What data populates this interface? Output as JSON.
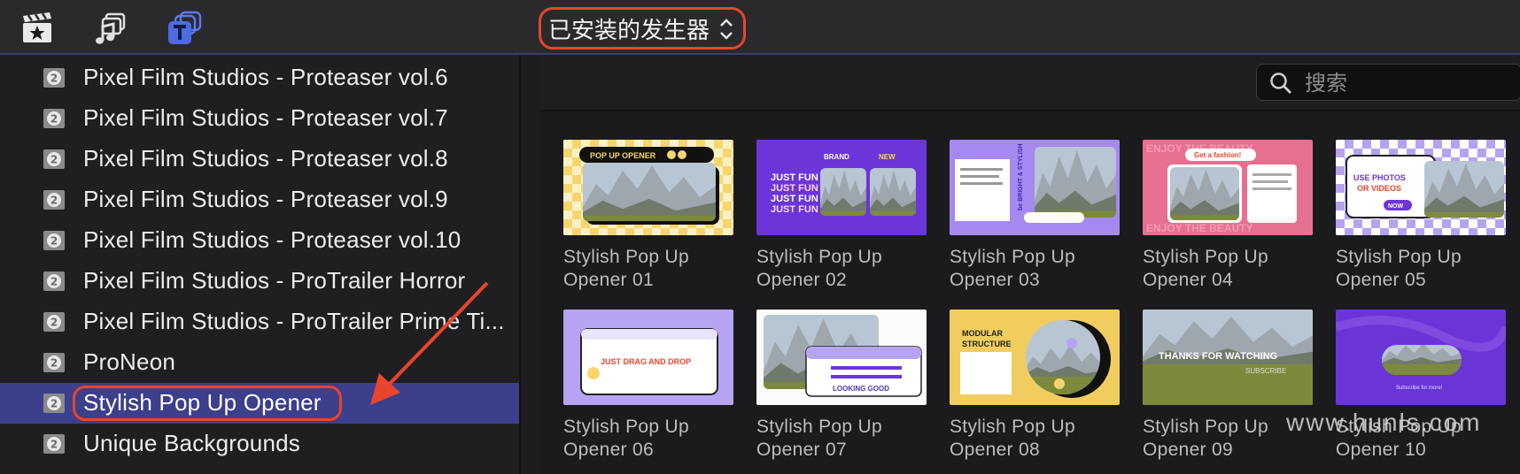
{
  "toolbar": {
    "icons": [
      "clapper-star-icon",
      "music-photo-icon",
      "titles-icon"
    ],
    "library_selector": "已安装的发生器"
  },
  "sidebar": {
    "items": [
      {
        "label": "Pixel Film Studios - Proteaser vol.6"
      },
      {
        "label": "Pixel Film Studios - Proteaser vol.7"
      },
      {
        "label": "Pixel Film Studios - Proteaser vol.8"
      },
      {
        "label": "Pixel Film Studios - Proteaser vol.9"
      },
      {
        "label": "Pixel Film Studios - Proteaser vol.10"
      },
      {
        "label": "Pixel Film Studios - ProTrailer Horror"
      },
      {
        "label": "Pixel Film Studios - ProTrailer Prime Ti..."
      },
      {
        "label": "ProNeon"
      },
      {
        "label": "Stylish Pop Up Opener",
        "selected": true
      },
      {
        "label": "Unique Backgrounds"
      }
    ]
  },
  "search": {
    "placeholder": "搜索"
  },
  "tiles": [
    {
      "line1": "Stylish Pop Up",
      "line2": "Opener 01",
      "thumb_text": "POP UP OPENER"
    },
    {
      "line1": "Stylish Pop Up",
      "line2": "Opener 02",
      "thumb_text": "JUST FUN"
    },
    {
      "line1": "Stylish Pop Up",
      "line2": "Opener 03",
      "thumb_text": "be BRIGHT & STYLISH"
    },
    {
      "line1": "Stylish Pop Up",
      "line2": "Opener 04",
      "thumb_text": "Get a fashion!"
    },
    {
      "line1": "Stylish Pop Up",
      "line2": "Opener 05",
      "thumb_text": "USE PHOTOS OR VIDEOS"
    },
    {
      "line1": "Stylish Pop Up",
      "line2": "Opener 06",
      "thumb_text": "JUST DRAG AND DROP"
    },
    {
      "line1": "Stylish Pop Up",
      "line2": "Opener 07",
      "thumb_text": "LOOKING GOOD"
    },
    {
      "line1": "Stylish Pop Up",
      "line2": "Opener 08",
      "thumb_text": "MODULAR STRUCTURE"
    },
    {
      "line1": "Stylish Pop Up",
      "line2": "Opener 09",
      "thumb_text": "THANKS FOR WATCHING"
    },
    {
      "line1": "Stylish Pop Up",
      "line2": "Opener 10",
      "thumb_text": "Subscribe for more!"
    }
  ],
  "watermark": "www.hunls.com",
  "colors": {
    "accent_selected": "#3b3f8c",
    "annotation_red": "#e8452c"
  }
}
